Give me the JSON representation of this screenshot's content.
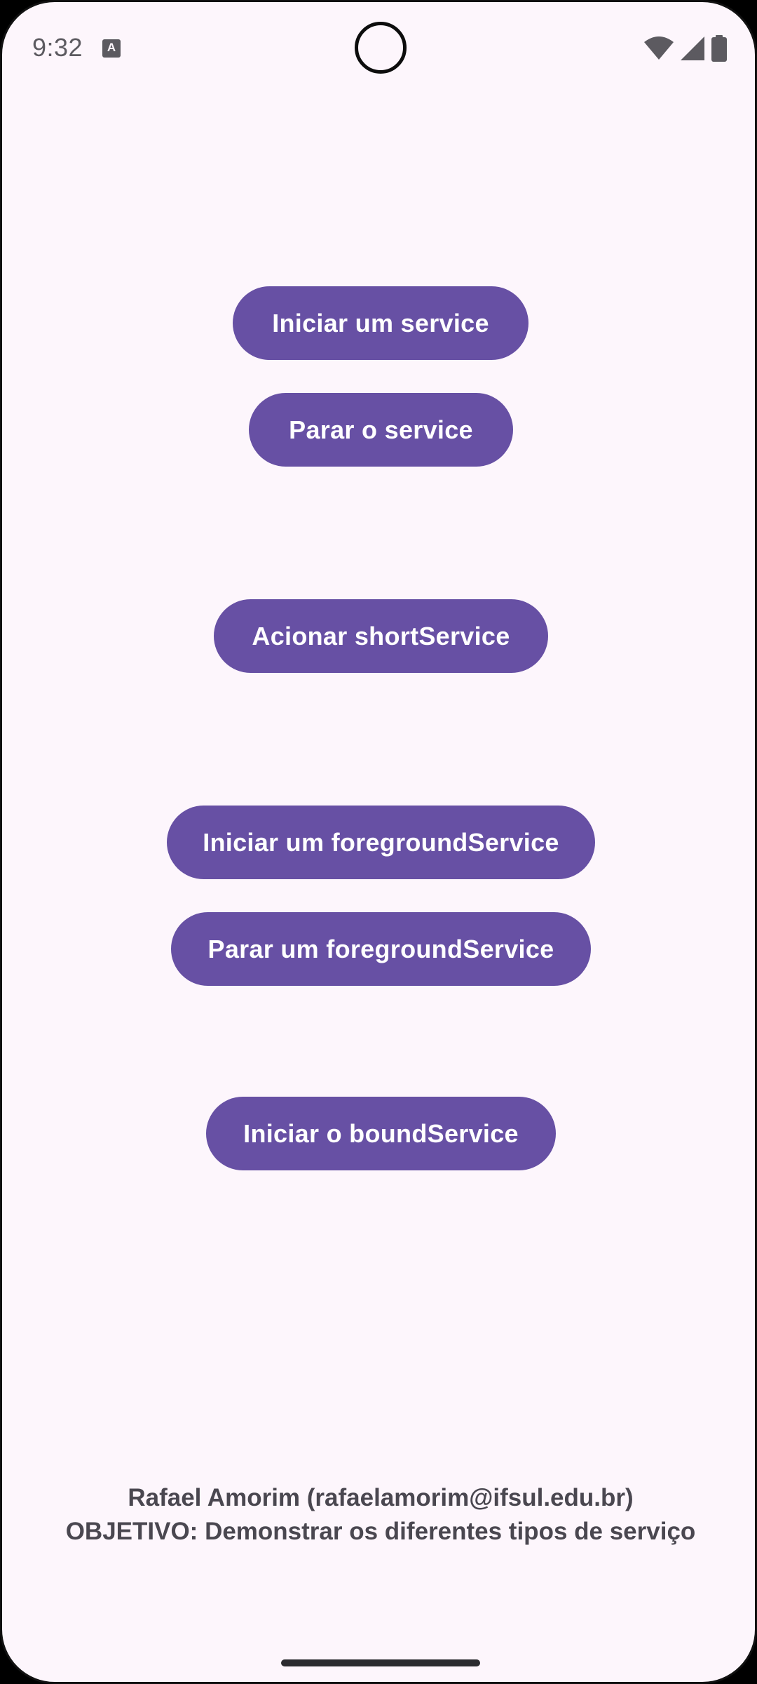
{
  "status_bar": {
    "time": "9:32",
    "notification_icon_letter": "A",
    "icons": [
      "wifi-icon",
      "cellular-signal-icon",
      "battery-icon"
    ]
  },
  "buttons": {
    "start_service": "Iniciar um service",
    "stop_service": "Parar o service",
    "short_service": "Acionar shortService",
    "start_foreground": "Iniciar um foregroundService",
    "stop_foreground": "Parar um foregroundService",
    "start_bound": "Iniciar o boundService"
  },
  "footer": {
    "author": "Rafael Amorim (rafaelamorim@ifsul.edu.br)",
    "objective": "OBJETIVO: Demonstrar os diferentes tipos de serviço"
  },
  "colors": {
    "background": "#fdf6fc",
    "button": "#6750a4",
    "button_text": "#ffffff",
    "footer_text": "#4a4750"
  }
}
